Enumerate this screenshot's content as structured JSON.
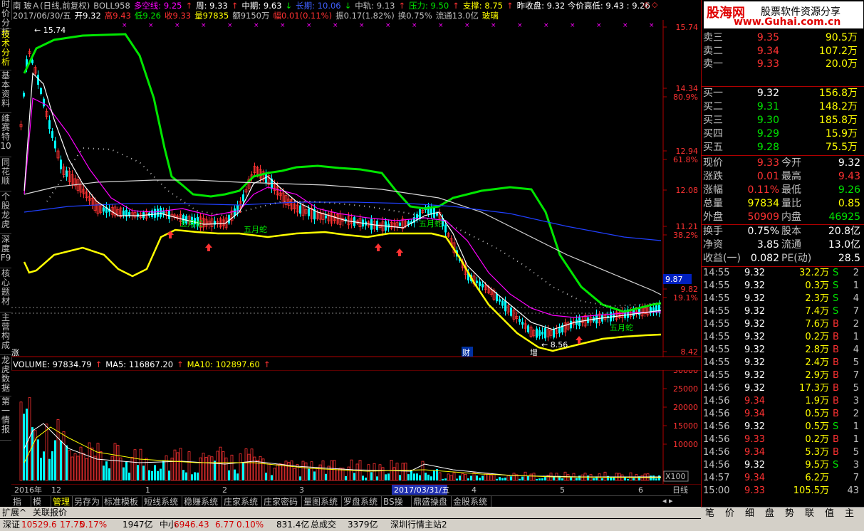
{
  "left_tabs": [
    "时价分析",
    "技术分析",
    "基本资料",
    "维赛特10",
    "同花顺",
    "个股龙虎",
    "深度F9",
    "核心题材",
    "主营构成",
    "龙虎数据",
    "第一情报"
  ],
  "header": {
    "row1": [
      {
        "text": "南 玻Ａ(日线,前复权)",
        "color": "#c0c0c0"
      },
      {
        "text": "BOLL958",
        "color": "#c0c0c0"
      },
      {
        "text": "多空线: 9.25",
        "color": "#ff00ff"
      },
      {
        "text": "↑",
        "color": "#ff3232"
      },
      {
        "text": "周: 9.33",
        "color": "#ffffff"
      },
      {
        "text": "↑",
        "color": "#ff3232"
      },
      {
        "text": "中期: 9.63",
        "color": "#ffffff"
      },
      {
        "text": "↓",
        "color": "#00e600"
      },
      {
        "text": "长期: 10.06",
        "color": "#4060ff"
      },
      {
        "text": "↓",
        "color": "#00e600"
      },
      {
        "text": "中轨: 9.13",
        "color": "#c0c0c0"
      },
      {
        "text": "↑",
        "color": "#ff3232"
      },
      {
        "text": "压力: 9.50",
        "color": "#00e600"
      },
      {
        "text": "↑",
        "color": "#ff3232"
      },
      {
        "text": "支撑: 8.75",
        "color": "#ffff00"
      },
      {
        "text": "↑",
        "color": "#ff3232"
      },
      {
        "text": "昨收盘: 9.32 今价高低: 9.43 : 9.26",
        "color": "#ffffff"
      }
    ],
    "row2": [
      {
        "text": "2017/06/30/五",
        "color": "#c0c0c0"
      },
      {
        "text": "开9.32",
        "color": "#ffffff"
      },
      {
        "text": "高9.43",
        "color": "#ff3232"
      },
      {
        "text": "低9.26",
        "color": "#00e600"
      },
      {
        "text": "收9.33",
        "color": "#ff3232"
      },
      {
        "text": "量97835",
        "color": "#ffff00"
      },
      {
        "text": "额9150万",
        "color": "#c0c0c0"
      },
      {
        "text": "幅0.01(0.11%)",
        "color": "#ff3232"
      },
      {
        "text": "振0.17(1.82%)",
        "color": "#c0c0c0"
      },
      {
        "text": "换0.75%",
        "color": "#c0c0c0"
      },
      {
        "text": "流通13.0亿",
        "color": "#c0c0c0"
      },
      {
        "text": "玻璃",
        "color": "#ffff00"
      }
    ]
  },
  "price_axis": [
    "15.74",
    "14.34",
    "80.9%",
    "12.94",
    "61.8%",
    "12.08",
    "11.21",
    "38.2%",
    "9.82",
    "19.1%",
    "8.42"
  ],
  "current_price_tag": "9.87",
  "chart_annotations": {
    "high_label": "15.74",
    "low_label": "8.56",
    "snake_labels": [
      "五月蛇",
      "五月蛇",
      "五月蛇",
      "五月蛇"
    ],
    "zhang": "涨",
    "cai": "财",
    "zeng": "增"
  },
  "volume_header": [
    {
      "text": "VOLUME: 97834.79",
      "color": "#ffffff"
    },
    {
      "text": "↑",
      "color": "#ff3232"
    },
    {
      "text": "MA5: 116867.20",
      "color": "#ffffff"
    },
    {
      "text": "↑",
      "color": "#ff3232"
    },
    {
      "text": "MA10: 102897.60",
      "color": "#ffff00"
    },
    {
      "text": "↑",
      "color": "#ff3232"
    }
  ],
  "volume_axis": [
    "30000",
    "25000",
    "20000",
    "15000",
    "10000"
  ],
  "volume_unit": "X100",
  "time_axis": {
    "labels": [
      "2016年",
      "12",
      "1",
      "2",
      "3",
      "4",
      "5",
      "6"
    ],
    "highlight": "2017/03/31/五",
    "period": "日线"
  },
  "bottom_tabs": [
    "指标",
    "模板",
    "管理",
    "另存为",
    "标准模板",
    "短线系统",
    "稳赚系统",
    "庄家系统",
    "庄家密码",
    "量图系统",
    "罗盘系统",
    "BS操盘",
    "鼎盛操盘",
    "金股系统"
  ],
  "bottom_tabs_active": "管理",
  "status_bar": {
    "expand": "扩展^",
    "related": "关联报价"
  },
  "ticker": [
    {
      "text": "深证",
      "color": "#000000"
    },
    {
      "text": "10529.6",
      "color": "#d00000"
    },
    {
      "text": "17.75",
      "color": "#d00000"
    },
    {
      "text": "0.17%",
      "color": "#d00000"
    },
    {
      "text": "1947亿",
      "color": "#000000"
    },
    {
      "text": "中小",
      "color": "#000000"
    },
    {
      "text": "6946.43",
      "color": "#d00000"
    },
    {
      "text": "6.77",
      "color": "#d00000"
    },
    {
      "text": "0.10%",
      "color": "#d00000"
    },
    {
      "text": "831.4亿",
      "color": "#000000"
    },
    {
      "text": "总成交",
      "color": "#000000"
    },
    {
      "text": "3379亿",
      "color": "#000000"
    },
    {
      "text": "深圳行情主站2",
      "color": "#000000"
    }
  ],
  "logo": {
    "brand": "股海网",
    "tagline": "股票软件资源分享",
    "url": "www.Guhai.com.cn"
  },
  "order_book": {
    "sells": [
      {
        "label": "卖三",
        "price": "9.35",
        "vol": "90.5万"
      },
      {
        "label": "卖二",
        "price": "9.34",
        "vol": "107.2万"
      },
      {
        "label": "卖一",
        "price": "9.33",
        "vol": "20.0万"
      }
    ],
    "buys": [
      {
        "label": "买一",
        "price": "9.32",
        "vol": "156.8万"
      },
      {
        "label": "买二",
        "price": "9.31",
        "vol": "148.2万"
      },
      {
        "label": "买三",
        "price": "9.30",
        "vol": "185.8万"
      },
      {
        "label": "买四",
        "price": "9.29",
        "vol": "15.9万"
      },
      {
        "label": "买五",
        "price": "9.28",
        "vol": "75.5万"
      }
    ]
  },
  "stats": [
    [
      {
        "t": "现价",
        "c": "#c0c0c0"
      },
      {
        "t": "9.33",
        "c": "#ff3232"
      },
      {
        "t": "今开",
        "c": "#c0c0c0"
      },
      {
        "t": "9.32",
        "c": "#ffffff"
      }
    ],
    [
      {
        "t": "涨跌",
        "c": "#c0c0c0"
      },
      {
        "t": "0.01",
        "c": "#ff3232"
      },
      {
        "t": "最高",
        "c": "#c0c0c0"
      },
      {
        "t": "9.43",
        "c": "#ff3232"
      }
    ],
    [
      {
        "t": "涨幅",
        "c": "#c0c0c0"
      },
      {
        "t": "0.11%",
        "c": "#ff3232"
      },
      {
        "t": "最低",
        "c": "#c0c0c0"
      },
      {
        "t": "9.26",
        "c": "#00e600"
      }
    ],
    [
      {
        "t": "总量",
        "c": "#c0c0c0"
      },
      {
        "t": "97834",
        "c": "#ffff00"
      },
      {
        "t": "量比",
        "c": "#c0c0c0"
      },
      {
        "t": "0.85",
        "c": "#ffff00"
      }
    ],
    [
      {
        "t": "外盘",
        "c": "#c0c0c0"
      },
      {
        "t": "50909",
        "c": "#ff3232"
      },
      {
        "t": "内盘",
        "c": "#c0c0c0"
      },
      {
        "t": "46925",
        "c": "#00e600"
      }
    ]
  ],
  "stats2": [
    [
      {
        "t": "换手",
        "c": "#c0c0c0"
      },
      {
        "t": "0.75%",
        "c": "#ffffff"
      },
      {
        "t": "股本",
        "c": "#c0c0c0"
      },
      {
        "t": "20.8亿",
        "c": "#ffffff"
      }
    ],
    [
      {
        "t": "净资",
        "c": "#c0c0c0"
      },
      {
        "t": "3.85",
        "c": "#ffffff"
      },
      {
        "t": "流通",
        "c": "#c0c0c0"
      },
      {
        "t": "13.0亿",
        "c": "#ffffff"
      }
    ],
    [
      {
        "t": "收益(一)",
        "c": "#c0c0c0"
      },
      {
        "t": "0.082",
        "c": "#ffffff"
      },
      {
        "t": "PE(动)",
        "c": "#c0c0c0"
      },
      {
        "t": "28.5",
        "c": "#ffffff"
      }
    ]
  ],
  "trades": [
    {
      "time": "14:55",
      "price": "9.32",
      "pc": "#ffffff",
      "vol": "32.2万",
      "flag": "S",
      "n": "2"
    },
    {
      "time": "14:55",
      "price": "9.32",
      "pc": "#ffffff",
      "vol": "0.3万",
      "flag": "S",
      "n": "1"
    },
    {
      "time": "14:55",
      "price": "9.32",
      "pc": "#ffffff",
      "vol": "2.3万",
      "flag": "S",
      "n": "4"
    },
    {
      "time": "14:55",
      "price": "9.32",
      "pc": "#ffffff",
      "vol": "7.4万",
      "flag": "S",
      "n": "7"
    },
    {
      "time": "14:55",
      "price": "9.32",
      "pc": "#ffffff",
      "vol": "7.6万",
      "flag": "B",
      "n": "2"
    },
    {
      "time": "14:55",
      "price": "9.32",
      "pc": "#ffffff",
      "vol": "0.2万",
      "flag": "B",
      "n": "1"
    },
    {
      "time": "14:55",
      "price": "9.32",
      "pc": "#ffffff",
      "vol": "2.8万",
      "flag": "B",
      "n": "4"
    },
    {
      "time": "14:55",
      "price": "9.32",
      "pc": "#ffffff",
      "vol": "2.4万",
      "flag": "B",
      "n": "5"
    },
    {
      "time": "14:55",
      "price": "9.32",
      "pc": "#ffffff",
      "vol": "2.9万",
      "flag": "B",
      "n": "7"
    },
    {
      "time": "14:56",
      "price": "9.32",
      "pc": "#ffffff",
      "vol": "17.3万",
      "flag": "B",
      "n": "5"
    },
    {
      "time": "14:56",
      "price": "9.34",
      "pc": "#ff3232",
      "vol": "1.9万",
      "flag": "B",
      "n": "3"
    },
    {
      "time": "14:56",
      "price": "9.34",
      "pc": "#ff3232",
      "vol": "0.5万",
      "flag": "B",
      "n": "2"
    },
    {
      "time": "14:56",
      "price": "9.32",
      "pc": "#ffffff",
      "vol": "0.5万",
      "flag": "S",
      "n": "1"
    },
    {
      "time": "14:56",
      "price": "9.33",
      "pc": "#ff3232",
      "vol": "0.2万",
      "flag": "B",
      "n": "1"
    },
    {
      "time": "14:56",
      "price": "9.34",
      "pc": "#ff3232",
      "vol": "5.3万",
      "flag": "B",
      "n": "5"
    },
    {
      "time": "14:56",
      "price": "9.32",
      "pc": "#ffffff",
      "vol": "9.5万",
      "flag": "S",
      "n": "3"
    },
    {
      "time": "14:57",
      "price": "9.34",
      "pc": "#ff3232",
      "vol": "6.2万",
      "flag": "",
      "n": "7"
    },
    {
      "time": "15:00",
      "price": "9.33",
      "pc": "#ff3232",
      "vol": "105.5万",
      "flag": "",
      "n": "43"
    }
  ],
  "right_tabs": [
    "笔",
    "价",
    "细",
    "盘",
    "势",
    "联",
    "值",
    "主"
  ],
  "colors": {
    "up": "#ff3232",
    "down": "#00ffff",
    "upper_band": "#00e600",
    "lower_band": "#ffff00",
    "ma_white": "#ffffff",
    "ma_magenta": "#ff00ff",
    "ma_blue": "#2040ff",
    "ma_gray": "#d8d8d8"
  }
}
